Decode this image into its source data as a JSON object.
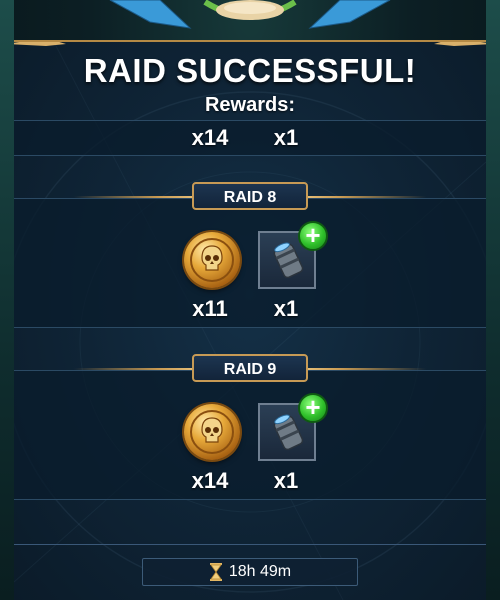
{
  "header": {
    "title": "RAID SUCCESSFUL!",
    "subtitle": "Rewards:"
  },
  "summary": {
    "silver_qty": "x14",
    "gem_qty": "x1"
  },
  "raids": [
    {
      "label": "RAID 8",
      "rewards": [
        {
          "icon": "skull-coin-icon",
          "qty": "x11"
        },
        {
          "icon": "gem-bundle-icon",
          "qty": "x1"
        }
      ]
    },
    {
      "label": "RAID 9",
      "rewards": [
        {
          "icon": "skull-coin-icon",
          "qty": "x14"
        },
        {
          "icon": "gem-bundle-icon",
          "qty": "x1"
        }
      ]
    }
  ],
  "timer": {
    "icon": "hourglass-icon",
    "value": "18h 49m"
  },
  "colors": {
    "gold_trim": "#c79a55",
    "panel_bg": "#0f2436",
    "plus_green": "#2fbf2a"
  }
}
